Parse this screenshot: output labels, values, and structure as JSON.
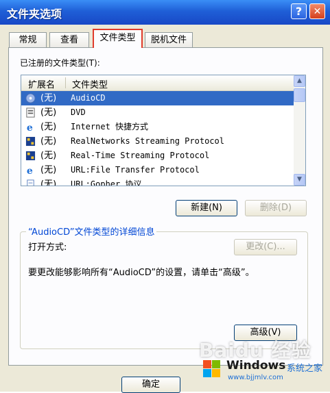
{
  "window": {
    "title": "文件夹选项",
    "help_btn": "?",
    "close_btn": "✕"
  },
  "tabs": [
    "常规",
    "查看",
    "文件类型",
    "脱机文件"
  ],
  "active_tab": "文件类型",
  "registered_label": "已注册的文件类型(T):",
  "list": {
    "col_ext": "扩展名",
    "col_type": "文件类型",
    "rows": [
      {
        "ext": "(无)",
        "type": "AudioCD",
        "icon": "cd-icon"
      },
      {
        "ext": "(无)",
        "type": "DVD",
        "icon": "dvd-icon"
      },
      {
        "ext": "(无)",
        "type": "Internet 快捷方式",
        "icon": "ie-icon"
      },
      {
        "ext": "(无)",
        "type": "RealNetworks Streaming Protocol",
        "icon": "media-icon"
      },
      {
        "ext": "(无)",
        "type": "Real-Time Streaming Protocol",
        "icon": "media-icon"
      },
      {
        "ext": "(无)",
        "type": "URL:File Transfer Protocol",
        "icon": "ie-icon"
      },
      {
        "ext": "(无)",
        "type": "URL:Gopher 协议",
        "icon": "doc-icon"
      }
    ],
    "selected_index": 0
  },
  "buttons": {
    "new": "新建(N)",
    "delete": "删除(D)",
    "change": "更改(C)...",
    "advanced": "高级(V)",
    "ok": "确定"
  },
  "details": {
    "title": "“AudioCD”文件类型的详细信息",
    "open_with_label": "打开方式:",
    "description": "要更改能够影响所有“AudioCD”的设置，请单击“高级”。"
  },
  "watermark": "Baidu 经验",
  "badge": {
    "brand": "Windows",
    "cn": "系统之家",
    "url": "www.bjjmlv.com"
  }
}
